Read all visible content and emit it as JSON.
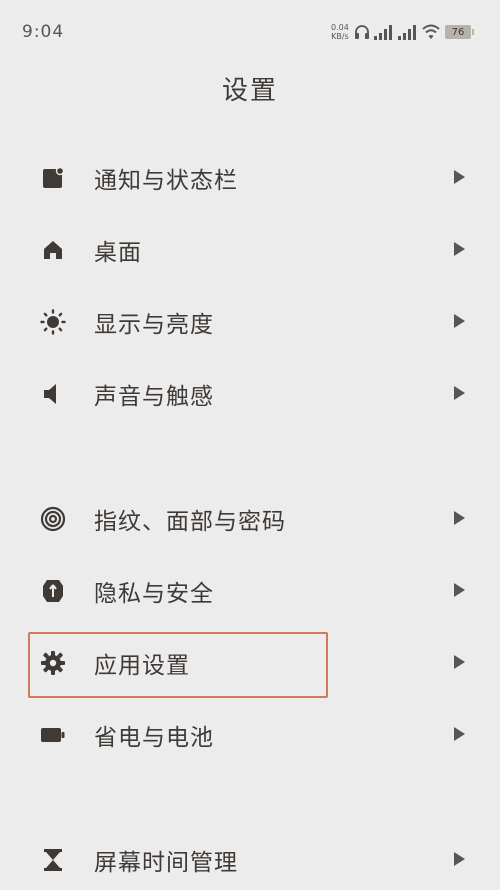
{
  "status": {
    "time": "9:04",
    "speed_value": "0.04",
    "speed_unit": "KB/s",
    "battery": "76",
    "icons": [
      "headphones-icon",
      "signal-icon",
      "signal-icon",
      "wifi-icon",
      "battery-icon"
    ]
  },
  "header": {
    "title": "设置"
  },
  "colors": {
    "text": "#3f3a36",
    "highlight": "#d07a5a",
    "background": "#ececec"
  },
  "settings": {
    "items": [
      {
        "label": "通知与状态栏",
        "icon": "notification-icon"
      },
      {
        "label": "桌面",
        "icon": "home-icon"
      },
      {
        "label": "显示与亮度",
        "icon": "brightness-icon"
      },
      {
        "label": "声音与触感",
        "icon": "speaker-icon"
      },
      {
        "label": "指纹、面部与密码",
        "icon": "fingerprint-icon"
      },
      {
        "label": "隐私与安全",
        "icon": "shield-icon"
      },
      {
        "label": "应用设置",
        "icon": "gear-icon"
      },
      {
        "label": "省电与电池",
        "icon": "battery-icon"
      },
      {
        "label": "屏幕时间管理",
        "icon": "hourglass-icon"
      }
    ]
  }
}
